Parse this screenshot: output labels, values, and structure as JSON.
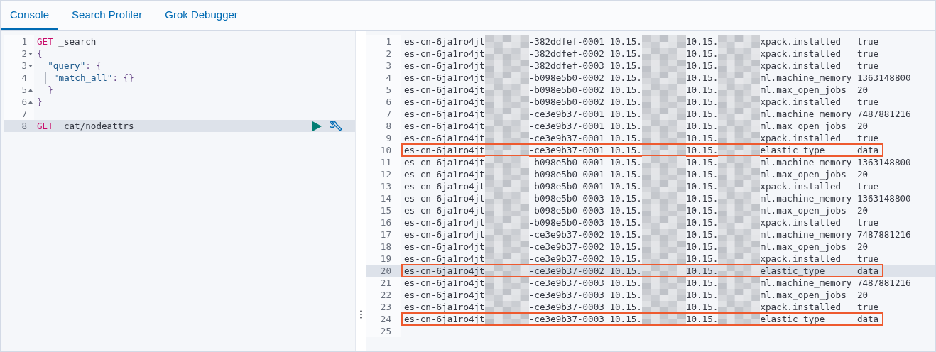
{
  "tabs": [
    {
      "label": "Console",
      "selected": true
    },
    {
      "label": "Search Profiler",
      "selected": false
    },
    {
      "label": "Grok Debugger",
      "selected": false
    }
  ],
  "editor": {
    "lines": [
      {
        "number": "1",
        "fold_start": false,
        "fold_end": false,
        "active": false,
        "indent_guide": false,
        "tokens": [
          {
            "kind": "method",
            "text": "GET"
          },
          {
            "kind": "path",
            "text": " _search"
          }
        ]
      },
      {
        "number": "2",
        "fold_start": true,
        "fold_end": false,
        "active": false,
        "indent_guide": false,
        "tokens": [
          {
            "kind": "punct",
            "text": "{"
          }
        ]
      },
      {
        "number": "3",
        "fold_start": true,
        "fold_end": false,
        "active": false,
        "indent_guide": false,
        "tokens": [
          {
            "kind": "key",
            "text": "  \"query\""
          },
          {
            "kind": "punct",
            "text": ": {"
          }
        ]
      },
      {
        "number": "4",
        "fold_start": false,
        "fold_end": false,
        "active": false,
        "indent_guide": true,
        "tokens": [
          {
            "kind": "key",
            "text": "\"match_all\""
          },
          {
            "kind": "punct",
            "text": ": {}"
          }
        ]
      },
      {
        "number": "5",
        "fold_start": false,
        "fold_end": true,
        "active": false,
        "indent_guide": false,
        "tokens": [
          {
            "kind": "punct",
            "text": "  }"
          }
        ]
      },
      {
        "number": "6",
        "fold_start": false,
        "fold_end": true,
        "active": false,
        "indent_guide": false,
        "tokens": [
          {
            "kind": "punct",
            "text": "}"
          }
        ]
      },
      {
        "number": "7",
        "fold_start": false,
        "fold_end": false,
        "active": false,
        "indent_guide": false
      },
      {
        "number": "8",
        "fold_start": false,
        "fold_end": false,
        "active": true,
        "indent_guide": false,
        "tokens": [
          {
            "kind": "method",
            "text": "GET"
          },
          {
            "kind": "path",
            "text": " _cat/nodeattrs"
          }
        ]
      }
    ]
  },
  "response": {
    "lines": [
      {
        "kind": "row",
        "number": "1",
        "node_prefix": "es-cn-6ja1ro4jt",
        "node_suffix": "-382ddfef-0001",
        "host": "10.15.",
        "ip": "10.15.",
        "attr": "xpack.installed",
        "value": "true",
        "highlighted": false,
        "active": false
      },
      {
        "kind": "row",
        "number": "2",
        "node_prefix": "es-cn-6ja1ro4jt",
        "node_suffix": "-382ddfef-0002",
        "host": "10.15.",
        "ip": "10.15.",
        "attr": "xpack.installed",
        "value": "true",
        "highlighted": false,
        "active": false
      },
      {
        "kind": "row",
        "number": "3",
        "node_prefix": "es-cn-6ja1ro4jt",
        "node_suffix": "-382ddfef-0003",
        "host": "10.15.",
        "ip": "10.15.",
        "attr": "xpack.installed",
        "value": "true",
        "highlighted": false,
        "active": false
      },
      {
        "kind": "row",
        "number": "4",
        "node_prefix": "es-cn-6ja1ro4jt",
        "node_suffix": "-b098e5b0-0002",
        "host": "10.15.",
        "ip": "10.15.",
        "attr": "ml.machine_memory",
        "value": "1363148800",
        "highlighted": false,
        "active": false
      },
      {
        "kind": "row",
        "number": "5",
        "node_prefix": "es-cn-6ja1ro4jt",
        "node_suffix": "-b098e5b0-0002",
        "host": "10.15.",
        "ip": "10.15.",
        "attr": "ml.max_open_jobs",
        "value": "20",
        "highlighted": false,
        "active": false
      },
      {
        "kind": "row",
        "number": "6",
        "node_prefix": "es-cn-6ja1ro4jt",
        "node_suffix": "-b098e5b0-0002",
        "host": "10.15.",
        "ip": "10.15.",
        "attr": "xpack.installed",
        "value": "true",
        "highlighted": false,
        "active": false
      },
      {
        "kind": "row",
        "number": "7",
        "node_prefix": "es-cn-6ja1ro4jt",
        "node_suffix": "-ce3e9b37-0001",
        "host": "10.15.",
        "ip": "10.15.",
        "attr": "ml.machine_memory",
        "value": "7487881216",
        "highlighted": false,
        "active": false
      },
      {
        "kind": "row",
        "number": "8",
        "node_prefix": "es-cn-6ja1ro4jt",
        "node_suffix": "-ce3e9b37-0001",
        "host": "10.15.",
        "ip": "10.15.",
        "attr": "ml.max_open_jobs",
        "value": "20",
        "highlighted": false,
        "active": false
      },
      {
        "kind": "row",
        "number": "9",
        "node_prefix": "es-cn-6ja1ro4jt",
        "node_suffix": "-ce3e9b37-0001",
        "host": "10.15.",
        "ip": "10.15.",
        "attr": "xpack.installed",
        "value": "true",
        "highlighted": false,
        "active": false
      },
      {
        "kind": "row",
        "number": "10",
        "node_prefix": "es-cn-6ja1ro4jt",
        "node_suffix": "-ce3e9b37-0001",
        "host": "10.15.",
        "ip": "10.15.",
        "attr": "elastic_type",
        "value": "data",
        "highlighted": true,
        "active": false
      },
      {
        "kind": "row",
        "number": "11",
        "node_prefix": "es-cn-6ja1ro4jt",
        "node_suffix": "-b098e5b0-0001",
        "host": "10.15.",
        "ip": "10.15.",
        "attr": "ml.machine_memory",
        "value": "1363148800",
        "highlighted": false,
        "active": false
      },
      {
        "kind": "row",
        "number": "12",
        "node_prefix": "es-cn-6ja1ro4jt",
        "node_suffix": "-b098e5b0-0001",
        "host": "10.15.",
        "ip": "10.15.",
        "attr": "ml.max_open_jobs",
        "value": "20",
        "highlighted": false,
        "active": false
      },
      {
        "kind": "row",
        "number": "13",
        "node_prefix": "es-cn-6ja1ro4jt",
        "node_suffix": "-b098e5b0-0001",
        "host": "10.15.",
        "ip": "10.15.",
        "attr": "xpack.installed",
        "value": "true",
        "highlighted": false,
        "active": false
      },
      {
        "kind": "row",
        "number": "14",
        "node_prefix": "es-cn-6ja1ro4jt",
        "node_suffix": "-b098e5b0-0003",
        "host": "10.15.",
        "ip": "10.15.",
        "attr": "ml.machine_memory",
        "value": "1363148800",
        "highlighted": false,
        "active": false
      },
      {
        "kind": "row",
        "number": "15",
        "node_prefix": "es-cn-6ja1ro4jt",
        "node_suffix": "-b098e5b0-0003",
        "host": "10.15.",
        "ip": "10.15.",
        "attr": "ml.max_open_jobs",
        "value": "20",
        "highlighted": false,
        "active": false
      },
      {
        "kind": "row",
        "number": "16",
        "node_prefix": "es-cn-6ja1ro4jt",
        "node_suffix": "-b098e5b0-0003",
        "host": "10.15.",
        "ip": "10.15.",
        "attr": "xpack.installed",
        "value": "true",
        "highlighted": false,
        "active": false
      },
      {
        "kind": "row",
        "number": "17",
        "node_prefix": "es-cn-6ja1ro4jt",
        "node_suffix": "-ce3e9b37-0002",
        "host": "10.15.",
        "ip": "10.15.",
        "attr": "ml.machine_memory",
        "value": "7487881216",
        "highlighted": false,
        "active": false
      },
      {
        "kind": "row",
        "number": "18",
        "node_prefix": "es-cn-6ja1ro4jt",
        "node_suffix": "-ce3e9b37-0002",
        "host": "10.15.",
        "ip": "10.15.",
        "attr": "ml.max_open_jobs",
        "value": "20",
        "highlighted": false,
        "active": false
      },
      {
        "kind": "row",
        "number": "19",
        "node_prefix": "es-cn-6ja1ro4jt",
        "node_suffix": "-ce3e9b37-0002",
        "host": "10.15.",
        "ip": "10.15.",
        "attr": "xpack.installed",
        "value": "true",
        "highlighted": false,
        "active": false
      },
      {
        "kind": "row",
        "number": "20",
        "node_prefix": "es-cn-6ja1ro4jt",
        "node_suffix": "-ce3e9b37-0002",
        "host": "10.15.",
        "ip": "10.15.",
        "attr": "elastic_type",
        "value": "data",
        "highlighted": true,
        "active": true
      },
      {
        "kind": "row",
        "number": "21",
        "node_prefix": "es-cn-6ja1ro4jt",
        "node_suffix": "-ce3e9b37-0003",
        "host": "10.15.",
        "ip": "10.15.",
        "attr": "ml.machine_memory",
        "value": "7487881216",
        "highlighted": false,
        "active": false
      },
      {
        "kind": "row",
        "number": "22",
        "node_prefix": "es-cn-6ja1ro4jt",
        "node_suffix": "-ce3e9b37-0003",
        "host": "10.15.",
        "ip": "10.15.",
        "attr": "ml.max_open_jobs",
        "value": "20",
        "highlighted": false,
        "active": false
      },
      {
        "kind": "row",
        "number": "23",
        "node_prefix": "es-cn-6ja1ro4jt",
        "node_suffix": "-ce3e9b37-0003",
        "host": "10.15.",
        "ip": "10.15.",
        "attr": "xpack.installed",
        "value": "true",
        "highlighted": false,
        "active": false
      },
      {
        "kind": "row",
        "number": "24",
        "node_prefix": "es-cn-6ja1ro4jt",
        "node_suffix": "-ce3e9b37-0003",
        "host": "10.15.",
        "ip": "10.15.",
        "attr": "elastic_type",
        "value": "data",
        "highlighted": true,
        "active": false
      },
      {
        "kind": "empty",
        "number": "25",
        "active": false
      }
    ]
  }
}
